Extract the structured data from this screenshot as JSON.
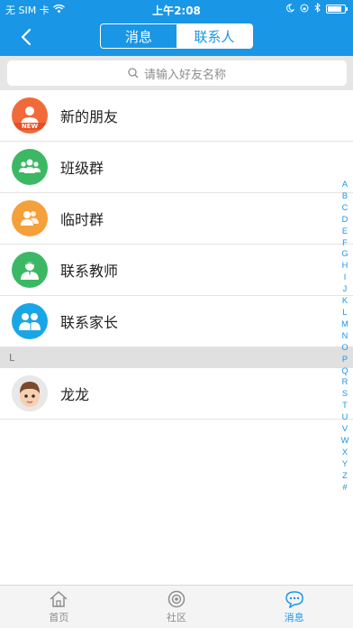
{
  "status_bar": {
    "carrier": "无 SIM 卡",
    "time": "上午2:08",
    "battery_level": 0.85
  },
  "nav": {
    "back_icon": "chevron-left-icon",
    "segments": [
      {
        "label": "消息",
        "active": false
      },
      {
        "label": "联系人",
        "active": true
      }
    ]
  },
  "search": {
    "placeholder": "请输入好友名称"
  },
  "groups": [
    {
      "label": "新的朋友",
      "icon": "new-friend-icon",
      "color": "#f26a3a",
      "badge": "NEW"
    },
    {
      "label": "班级群",
      "icon": "class-group-icon",
      "color": "#3cb864"
    },
    {
      "label": "临时群",
      "icon": "temp-group-icon",
      "color": "#f5a03a"
    },
    {
      "label": "联系教师",
      "icon": "teacher-icon",
      "color": "#3cb864"
    },
    {
      "label": "联系家长",
      "icon": "parents-icon",
      "color": "#1aa6e6"
    }
  ],
  "section": {
    "letter": "L",
    "contacts": [
      {
        "name": "龙龙",
        "icon": "child-avatar-icon"
      }
    ]
  },
  "index_letters": [
    "A",
    "B",
    "C",
    "D",
    "E",
    "F",
    "G",
    "H",
    "I",
    "J",
    "K",
    "L",
    "M",
    "N",
    "O",
    "P",
    "Q",
    "R",
    "S",
    "T",
    "U",
    "V",
    "W",
    "X",
    "Y",
    "Z",
    "#"
  ],
  "tabs": [
    {
      "label": "首页",
      "icon": "home-icon",
      "active": false
    },
    {
      "label": "社区",
      "icon": "community-icon",
      "active": false
    },
    {
      "label": "消息",
      "icon": "message-icon",
      "active": true
    }
  ],
  "colors": {
    "primary": "#1a96e6",
    "section_bg": "#e0e0e0",
    "tabbar_bg": "#f4f4f4"
  }
}
